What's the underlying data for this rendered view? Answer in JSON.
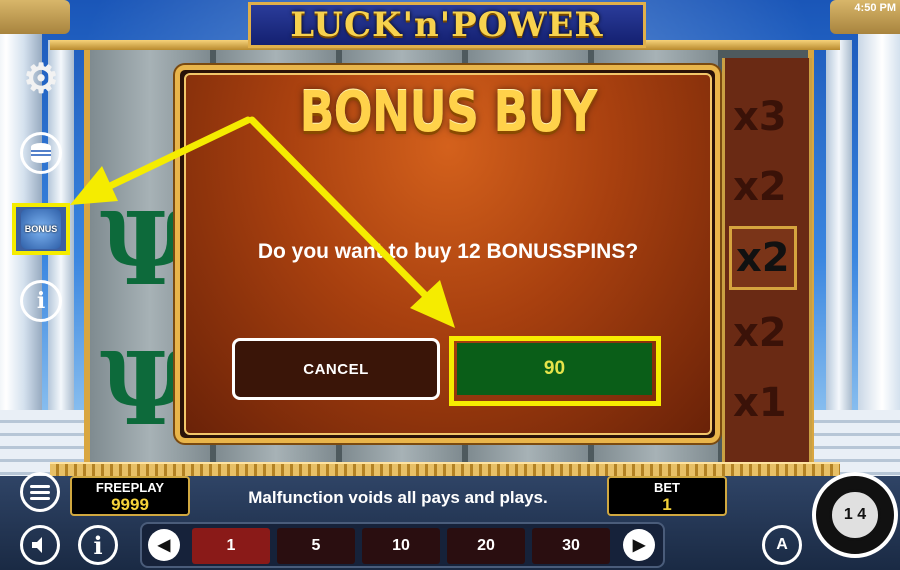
{
  "game": {
    "title": "LUCK'n'POWER",
    "clock": "4:50 PM"
  },
  "side_icons": {
    "settings": "gear-icon",
    "coins": "coins-icon",
    "bonus_label": "BONUS",
    "info": "i"
  },
  "reels": {
    "symbol": "Ψ",
    "multipliers": [
      "x3",
      "x2",
      "x2",
      "x2",
      "x1"
    ]
  },
  "dialog": {
    "title": "BONUS BUY",
    "question": "Do you want to buy 12 BONUSSPINS?",
    "cancel_label": "CANCEL",
    "buy_price": "90"
  },
  "bottom": {
    "freeplay_label": "FREEPLAY",
    "freeplay_value": "9999",
    "notice": "Malfunction voids all pays and plays.",
    "bet_label": "BET",
    "bet_value": "1",
    "bet_options": [
      "1",
      "5",
      "10",
      "20",
      "30"
    ],
    "selected_bet": "1",
    "info_label": "i",
    "auto_label": "A",
    "spin_label": "1 4"
  },
  "colors": {
    "highlight": "#f6ec00",
    "buy_button": "#0a5e18",
    "dialog_bg": "#a8400f",
    "title_gold": "#ffd24a"
  }
}
